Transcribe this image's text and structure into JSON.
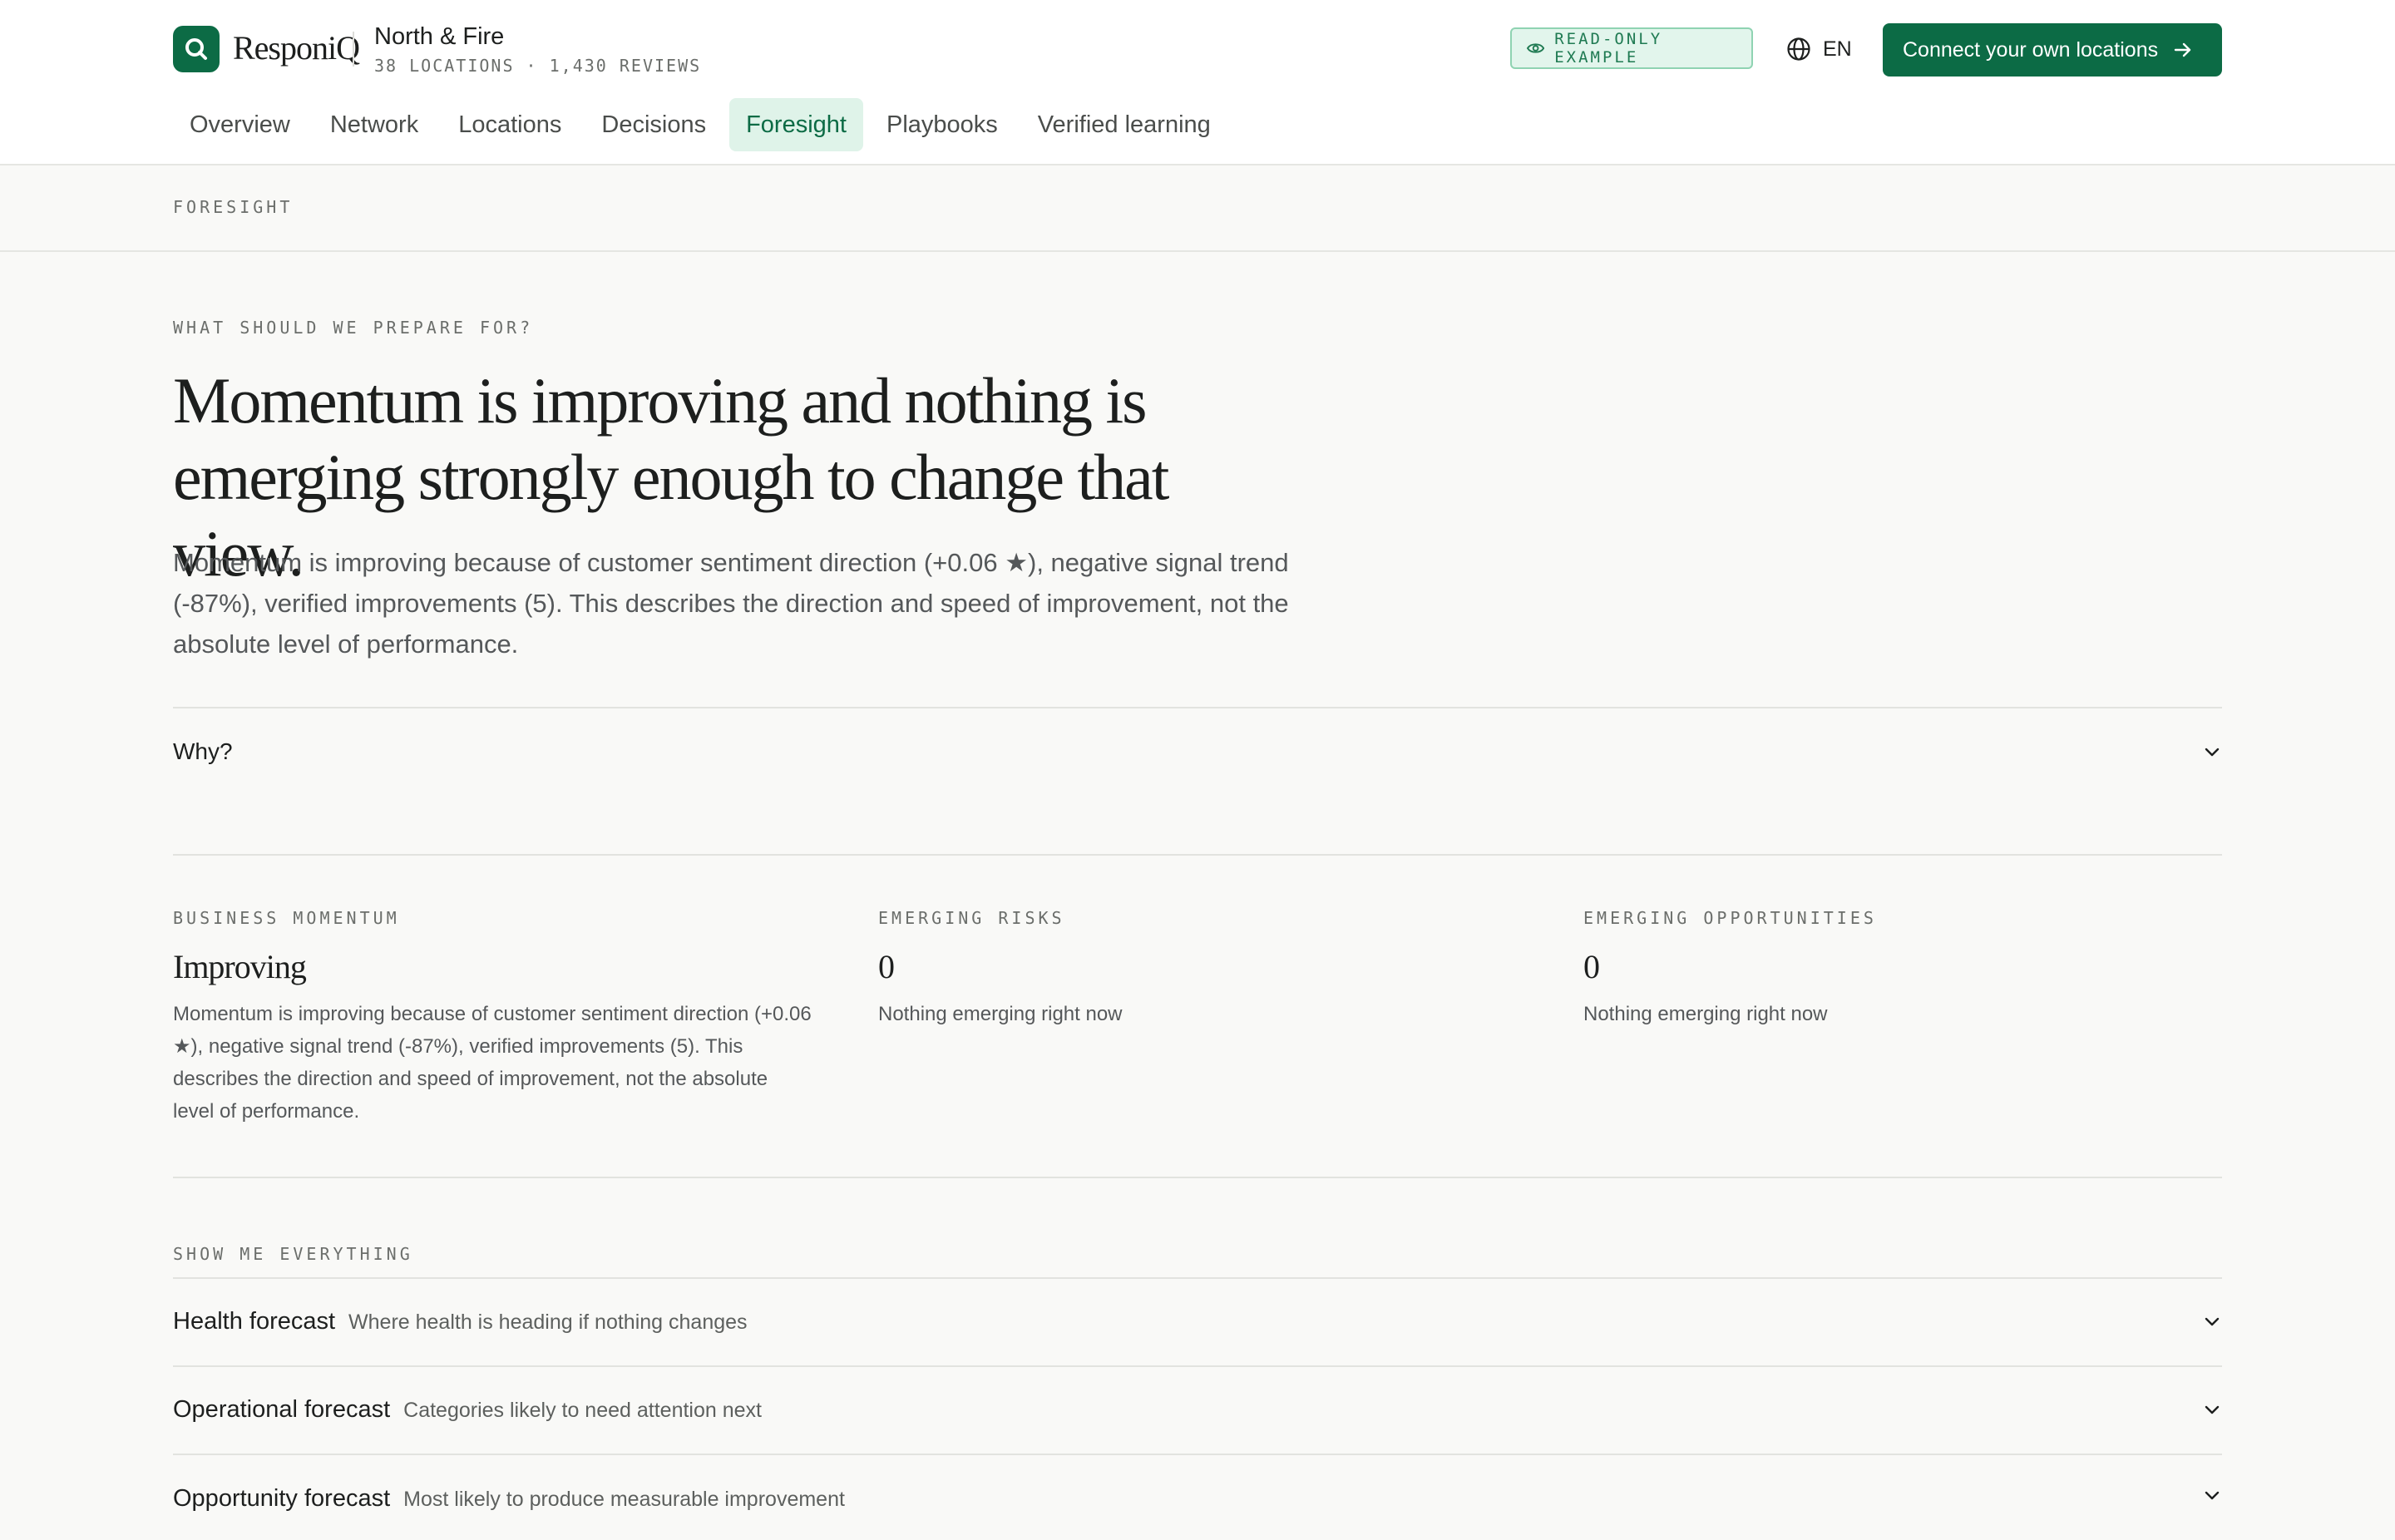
{
  "brand": {
    "name": "ResponiQ"
  },
  "org": {
    "name": "North & Fire",
    "meta": "38 LOCATIONS · 1,430 REVIEWS"
  },
  "header": {
    "badge": "READ-ONLY EXAMPLE",
    "language": "EN",
    "cta": "Connect your own locations"
  },
  "nav": {
    "items": [
      {
        "label": "Overview"
      },
      {
        "label": "Network"
      },
      {
        "label": "Locations"
      },
      {
        "label": "Decisions"
      },
      {
        "label": "Foresight",
        "active": true
      },
      {
        "label": "Playbooks"
      },
      {
        "label": "Verified learning"
      }
    ]
  },
  "breadcrumb": "FORESIGHT",
  "hero": {
    "eyebrow": "WHAT SHOULD WE PREPARE FOR?",
    "title_line1": "Momentum is improving and nothing is",
    "title_line2": "emerging strongly enough to change that view.",
    "description": "Momentum is improving because of customer sentiment direction (+0.06 ★), negative signal trend (-87%), verified improvements (5). This describes the direction and speed of improvement, not the absolute level of performance."
  },
  "why": {
    "label": "Why?"
  },
  "metrics": [
    {
      "label": "BUSINESS MOMENTUM",
      "value": "Improving",
      "description": "Momentum is improving because of customer sentiment direction (+0.06 ★), negative signal trend (-87%), verified improvements (5). This describes the direction and speed of improvement, not the absolute level of performance."
    },
    {
      "label": "EMERGING RISKS",
      "value": "0",
      "description": "Nothing emerging right now"
    },
    {
      "label": "EMERGING OPPORTUNITIES",
      "value": "0",
      "description": "Nothing emerging right now"
    }
  ],
  "show_all": {
    "label": "SHOW ME EVERYTHING",
    "items": [
      {
        "title": "Health forecast",
        "subtitle": "Where health is heading if nothing changes"
      },
      {
        "title": "Operational forecast",
        "subtitle": "Categories likely to need attention next"
      },
      {
        "title": "Opportunity forecast",
        "subtitle": "Most likely to produce measurable improvement"
      }
    ]
  },
  "colors": {
    "accent": "#0c6b45",
    "accent_light": "#dff3e9",
    "background": "#f9f9f7"
  }
}
